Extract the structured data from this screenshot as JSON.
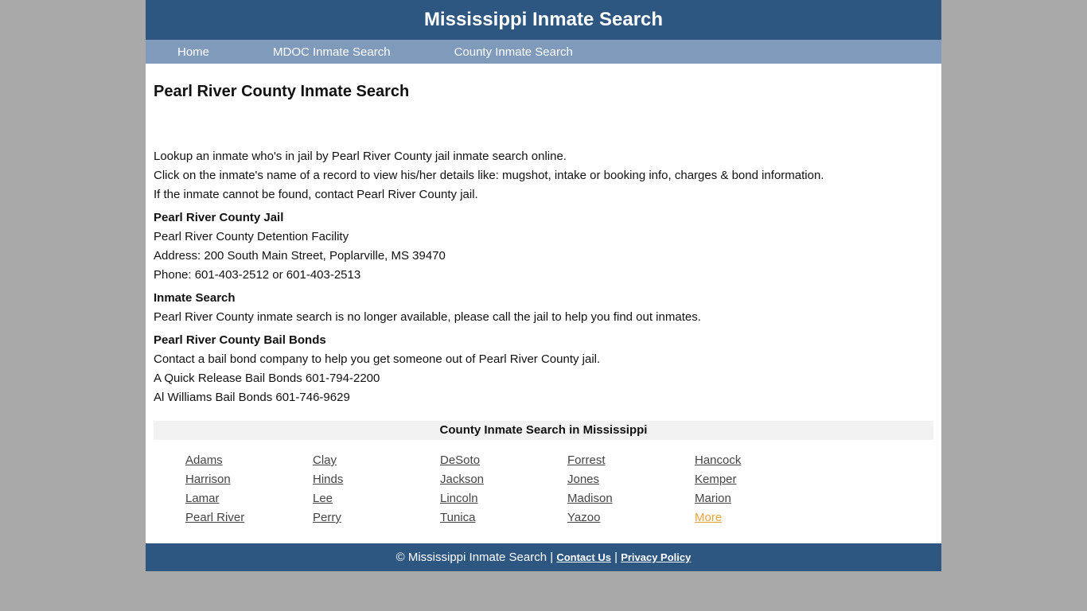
{
  "header": {
    "title": "Mississippi Inmate Search"
  },
  "nav": [
    {
      "label": "Home"
    },
    {
      "label": "MDOC Inmate Search"
    },
    {
      "label": "County Inmate Search"
    }
  ],
  "page_title": "Pearl River County Inmate Search",
  "intro": [
    "Lookup an inmate who's in jail by Pearl River County jail inmate search online.",
    "Click on the inmate's name of a record to view his/her details like: mugshot, intake or booking info, charges & bond information.",
    "If the inmate cannot be found, contact Pearl River County jail."
  ],
  "jail": {
    "title": "Pearl River County Jail",
    "lines": [
      "Pearl River County Detention Facility",
      "Address: 200 South Main Street, Poplarville, MS 39470",
      "Phone: 601-403-2512 or 601-403-2513"
    ]
  },
  "inmate_search": {
    "title": "Inmate Search",
    "lines": [
      "Pearl River County inmate search is no longer available, please call the jail to help you find out inmates."
    ]
  },
  "bail": {
    "title": "Pearl River County Bail Bonds",
    "lines": [
      "Contact a bail bond company to help you get someone out of Pearl River County jail.",
      "A Quick Release Bail Bonds 601-794-2200",
      "Al Williams Bail Bonds 601-746-9629"
    ]
  },
  "counties": {
    "title": "County Inmate Search in Mississippi",
    "links": [
      "Adams",
      "Clay",
      "DeSoto",
      "Forrest",
      "Hancock",
      "Harrison",
      "Hinds",
      "Jackson",
      "Jones",
      "Kemper",
      "Lamar",
      "Lee",
      "Lincoln",
      "Madison",
      "Marion",
      "Pearl River",
      "Perry",
      "Tunica",
      "Yazoo",
      "More"
    ]
  },
  "footer": {
    "copyright": "© Mississippi Inmate Search |",
    "separator": "|",
    "contact": "Contact Us",
    "privacy": "Privacy Policy"
  }
}
